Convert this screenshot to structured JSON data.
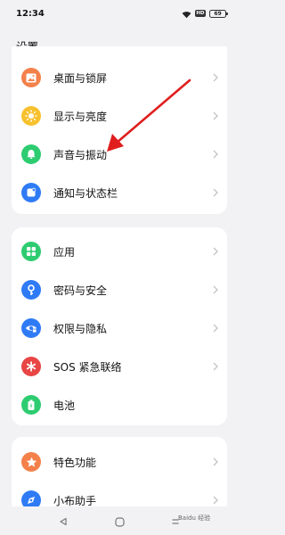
{
  "status_bar": {
    "time": "12:34",
    "hd_label": "HD",
    "battery_level": "69",
    "icons": [
      "wifi-icon",
      "hd-icon",
      "battery-icon"
    ]
  },
  "page": {
    "title": "设置"
  },
  "groups": [
    {
      "items": [
        {
          "label": "桌面与锁屏",
          "icon": "wallpaper-icon",
          "color": "#F4804A"
        },
        {
          "label": "显示与亮度",
          "icon": "sun-icon",
          "color": "#F7C12D"
        },
        {
          "label": "声音与振动",
          "icon": "bell-icon",
          "color": "#2ECC71"
        },
        {
          "label": "通知与状态栏",
          "icon": "notification-icon",
          "color": "#2F7BF6"
        }
      ]
    },
    {
      "items": [
        {
          "label": "应用",
          "icon": "apps-grid-icon",
          "color": "#2ECC71"
        },
        {
          "label": "密码与安全",
          "icon": "key-icon",
          "color": "#2F7BF6"
        },
        {
          "label": "权限与隐私",
          "icon": "privacy-eye-icon",
          "color": "#2F7BF6"
        },
        {
          "label": "SOS 紧急联络",
          "icon": "sos-asterisk-icon",
          "color": "#E84545"
        },
        {
          "label": "电池",
          "icon": "battery-icon",
          "color": "#2ECC71"
        }
      ]
    },
    {
      "items": [
        {
          "label": "特色功能",
          "icon": "star-icon",
          "color": "#F4804A"
        },
        {
          "label": "小布助手",
          "icon": "assistant-icon",
          "color": "#2F7BF6"
        }
      ]
    }
  ],
  "annotation": {
    "color": "#E01E1E",
    "icon": "red-arrow-icon"
  },
  "nav_bar": {
    "icons": [
      "back-triangle-icon",
      "home-circle-icon",
      "recents-square-icon"
    ]
  },
  "watermark": {
    "text": "Baidu 经验"
  }
}
